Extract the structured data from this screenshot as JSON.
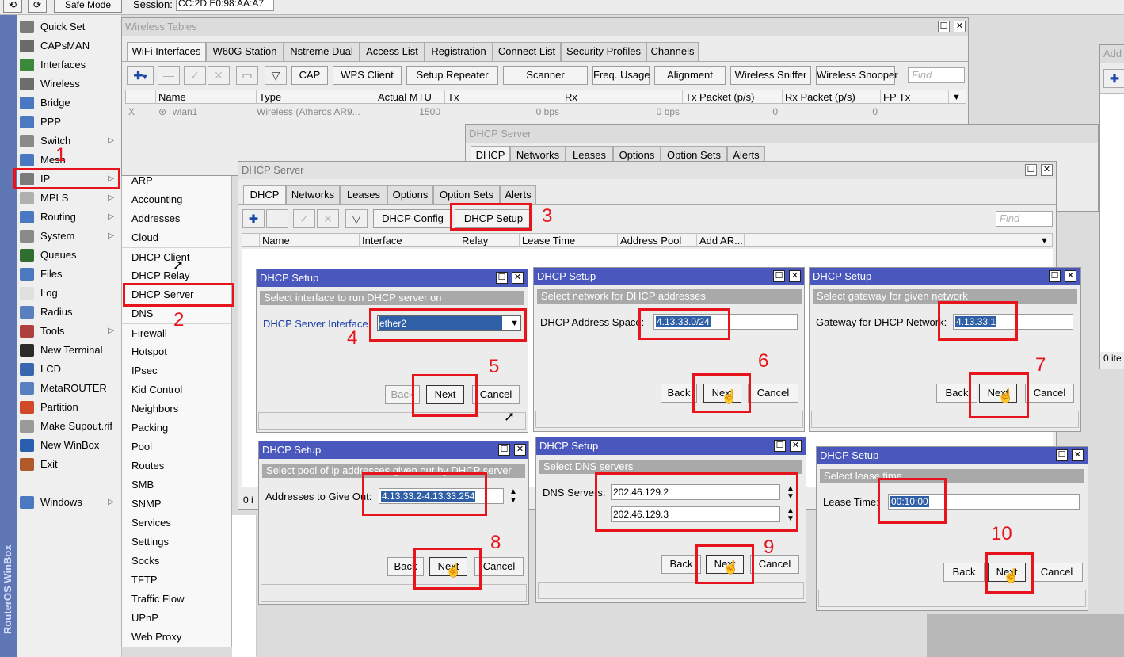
{
  "topbar": {
    "undo": "⟲",
    "redo": "⟳",
    "safe_mode": "Safe Mode",
    "session_label": "Session:",
    "session_value": "CC:2D:E0:98:AA:A7"
  },
  "winbox_label": "RouterOS WinBox",
  "main_menu": [
    {
      "label": "Quick Set",
      "icon": "quick-set-icon",
      "color": "#7b7b7b"
    },
    {
      "label": "CAPsMAN",
      "icon": "capsman-icon",
      "color": "#6a6a6a"
    },
    {
      "label": "Interfaces",
      "icon": "interfaces-icon",
      "color": "#3b8a3b"
    },
    {
      "label": "Wireless",
      "icon": "wireless-icon",
      "color": "#6d6d6d"
    },
    {
      "label": "Bridge",
      "icon": "bridge-icon",
      "color": "#4a79c2"
    },
    {
      "label": "PPP",
      "icon": "ppp-icon",
      "color": "#4a79c2"
    },
    {
      "label": "Switch",
      "icon": "switch-icon",
      "color": "#8a8a8a",
      "arrow": "▷"
    },
    {
      "label": "Mesh",
      "icon": "mesh-icon",
      "color": "#4a79c2"
    },
    {
      "label": "IP",
      "icon": "ip-icon",
      "color": "#7a7a7a",
      "arrow": "▷"
    },
    {
      "label": "MPLS",
      "icon": "mpls-icon",
      "color": "#b0b0b0",
      "arrow": "▷"
    },
    {
      "label": "Routing",
      "icon": "routing-icon",
      "color": "#4a79c2",
      "arrow": "▷"
    },
    {
      "label": "System",
      "icon": "system-icon",
      "color": "#8a8a8a",
      "arrow": "▷"
    },
    {
      "label": "Queues",
      "icon": "queues-icon",
      "color": "#2f6e2f"
    },
    {
      "label": "Files",
      "icon": "files-icon",
      "color": "#4a79c2"
    },
    {
      "label": "Log",
      "icon": "log-icon",
      "color": "#e0e0e0"
    },
    {
      "label": "Radius",
      "icon": "radius-icon",
      "color": "#5a7fc0"
    },
    {
      "label": "Tools",
      "icon": "tools-icon",
      "color": "#b04040",
      "arrow": "▷"
    },
    {
      "label": "New Terminal",
      "icon": "terminal-icon",
      "color": "#2a2a2a"
    },
    {
      "label": "LCD",
      "icon": "lcd-icon",
      "color": "#3a66b0"
    },
    {
      "label": "MetaROUTER",
      "icon": "metarouter-icon",
      "color": "#5a7fc0"
    },
    {
      "label": "Partition",
      "icon": "partition-icon",
      "color": "#d04a2a"
    },
    {
      "label": "Make Supout.rif",
      "icon": "supout-icon",
      "color": "#9a9a9a"
    },
    {
      "label": "New WinBox",
      "icon": "winbox-icon",
      "color": "#2a5fb0"
    },
    {
      "label": "Exit",
      "icon": "exit-icon",
      "color": "#b05a2a"
    },
    {
      "label": "Windows",
      "icon": "windows-icon",
      "color": "#4a79c2",
      "arrow": "▷"
    }
  ],
  "ip_submenu": [
    "ARP",
    "Accounting",
    "Addresses",
    "Cloud",
    "DHCP Client",
    "DHCP Relay",
    "DHCP Server",
    "DNS",
    "Firewall",
    "Hotspot",
    "IPsec",
    "Kid Control",
    "Neighbors",
    "Packing",
    "Pool",
    "Routes",
    "SMB",
    "SNMP",
    "Services",
    "Settings",
    "Socks",
    "TFTP",
    "Traffic Flow",
    "UPnP",
    "Web Proxy"
  ],
  "wireless_tables": {
    "title": "Wireless Tables",
    "tabs": [
      "WiFi Interfaces",
      "W60G Station",
      "Nstreme Dual",
      "Access List",
      "Registration",
      "Connect List",
      "Security Profiles",
      "Channels"
    ],
    "buttons": [
      "CAP",
      "WPS Client",
      "Setup Repeater",
      "Scanner",
      "Freq. Usage",
      "Alignment",
      "Wireless Sniffer",
      "Wireless Snooper"
    ],
    "find": "Find",
    "columns": [
      "Name",
      "Type",
      "Actual MTU",
      "Tx",
      "Rx",
      "Tx Packet (p/s)",
      "Rx Packet (p/s)",
      "FP Tx"
    ],
    "row": {
      "flag": "X",
      "name": "wlan1",
      "type": "Wireless (Atheros AR9...",
      "mtu": "1500",
      "tx": "0 bps",
      "rx": "0 bps",
      "txp": "0",
      "rxp": "0"
    }
  },
  "bg_dhcp": {
    "title": "DHCP Server",
    "tabs": [
      "DHCP",
      "Networks",
      "Leases",
      "Options",
      "Option Sets",
      "Alerts"
    ]
  },
  "add_window": {
    "title": "Add",
    "status": "0 ite"
  },
  "dhcp_server": {
    "title": "DHCP Server",
    "tabs": [
      "DHCP",
      "Networks",
      "Leases",
      "Options",
      "Option Sets",
      "Alerts"
    ],
    "buttons": [
      "DHCP Config",
      "DHCP Setup"
    ],
    "find": "Find",
    "columns": [
      "Name",
      "Interface",
      "Relay",
      "Lease Time",
      "Address Pool",
      "Add AR..."
    ],
    "status": "0 i"
  },
  "setup": {
    "title": "DHCP Setup",
    "back": "Back",
    "next": "Next",
    "cancel": "Cancel",
    "interface": {
      "section": "Select interface to run DHCP server on",
      "label": "DHCP Server Interface:",
      "value": "ether2"
    },
    "space": {
      "section": "Select network for DHCP addresses",
      "label": "DHCP Address Space:",
      "value": "4.13.33.0/24"
    },
    "gateway": {
      "section": "Select gateway for given network",
      "label": "Gateway for DHCP Network:",
      "value": "4.13.33.1"
    },
    "pool": {
      "section": "Select pool of ip addresses given out by DHCP server",
      "label": "Addresses to Give Out:",
      "value": "4.13.33.2-4.13.33.254"
    },
    "dns": {
      "section": "Select DNS servers",
      "label": "DNS Servers:",
      "value1": "202.46.129.2",
      "value2": "202.46.129.3"
    },
    "lease": {
      "section": "Select lease time",
      "label": "Lease Time:",
      "value": "00:10:00"
    }
  },
  "steps": [
    "1",
    "2",
    "3",
    "4",
    "5",
    "6",
    "7",
    "8",
    "9",
    "10"
  ],
  "colors": {
    "highlight": "#e8141c",
    "title_active": "#4a57bd",
    "left_strip": "#5f78b5"
  }
}
